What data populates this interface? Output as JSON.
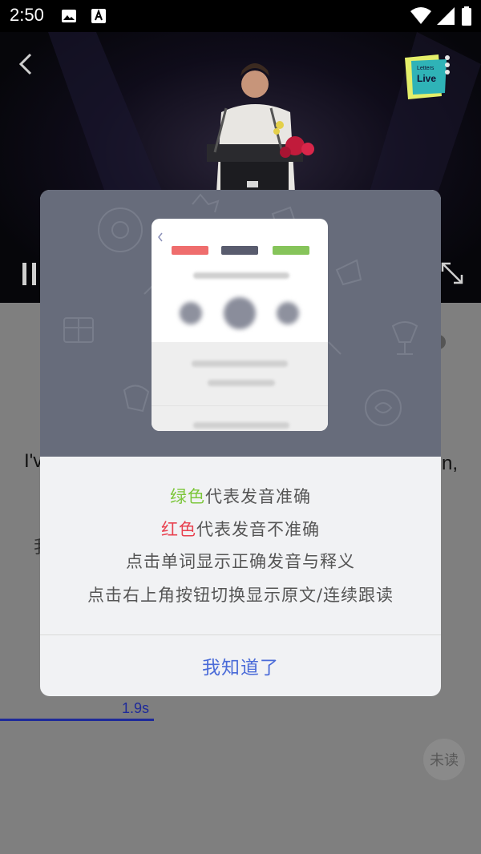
{
  "status_bar": {
    "time": "2:50"
  },
  "video": {
    "logo_line1": "Letters",
    "logo_line2": "Live"
  },
  "content": {
    "line_start": "I'v",
    "line_end": "n,",
    "sub_start": "我",
    "progress_time": "1.9s",
    "unread_label": "未读"
  },
  "dialog": {
    "line1": {
      "highlight": "绿色",
      "rest": "代表发音准确",
      "color": "#7cc63a"
    },
    "line2": {
      "highlight": "红色",
      "rest": "代表发音不准确",
      "color": "#e8414f"
    },
    "line3": "点击单词显示正确发音与释义",
    "line4": "点击右上角按钮切换显示原文/连续跟读",
    "ok_button": "我知道了",
    "preview_bars": [
      "#ef6d6d",
      "#595c6e",
      "#86c45a"
    ]
  }
}
